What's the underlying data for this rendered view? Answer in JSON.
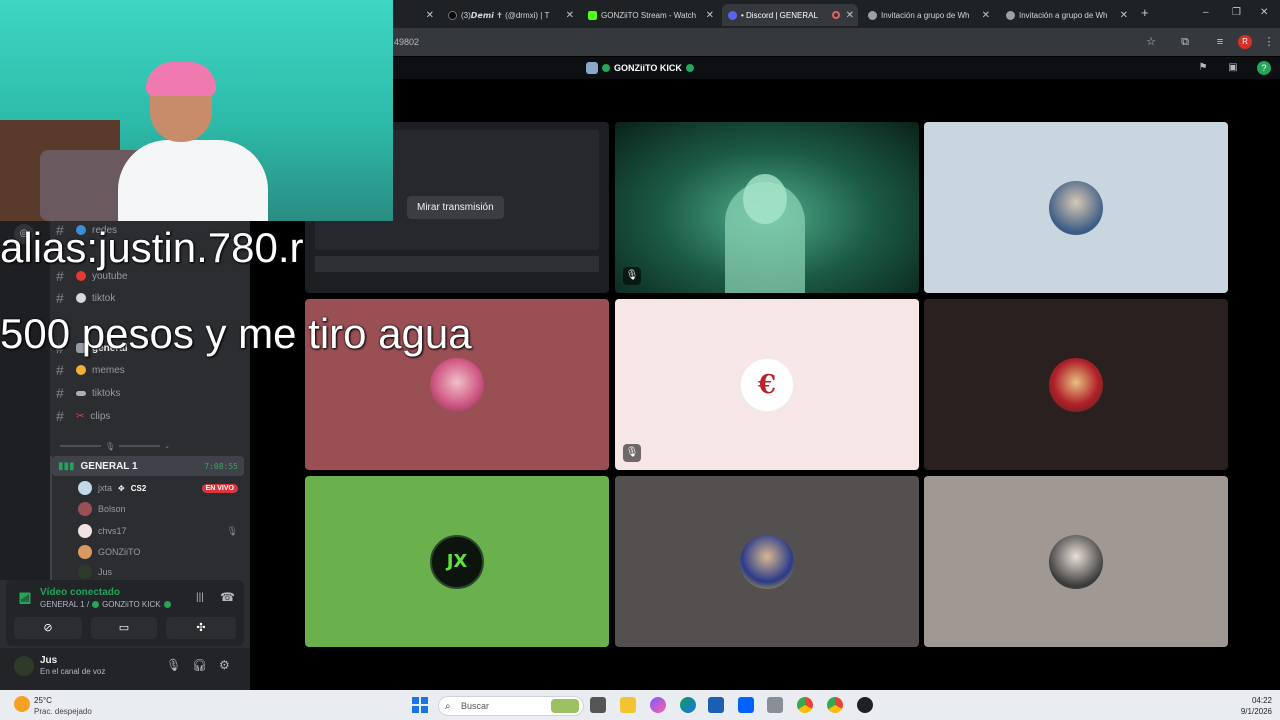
{
  "browser": {
    "tabs": [
      {
        "label": "(3)𝘿𝙚𝙢𝙞 ✝ (@drmxi) | T",
        "color": "#000000"
      },
      {
        "label": "GONZiiTO Stream - Watch",
        "color": "#53fc18"
      },
      {
        "label": "• Discord | GENERAL",
        "color": "#5865f2"
      },
      {
        "label": "Invitación a grupo de Wh",
        "color": "#9aa0a6"
      },
      {
        "label": "Invitación a grupo de Wh",
        "color": "#9aa0a6"
      }
    ],
    "url_fragment": "49802",
    "profile_initial": "R"
  },
  "discord": {
    "header": {
      "call_name": "GONZiiTO KICK"
    },
    "stage": {
      "watch_button": "Mirar transmisión",
      "tiles": [
        {
          "name": "stream-preview",
          "bg": "#1e1f22"
        },
        {
          "name": "camera-feed",
          "bg": "#0f3a2e"
        },
        {
          "name": "avatar-tile-1",
          "bg": "#c9d6df"
        },
        {
          "name": "avatar-tile-2",
          "bg": "#9a4f55"
        },
        {
          "name": "avatar-tile-3",
          "bg": "#f6e6e6"
        },
        {
          "name": "avatar-tile-4",
          "bg": "#2b2020"
        },
        {
          "name": "avatar-tile-5",
          "bg": "#6ab04c"
        },
        {
          "name": "avatar-tile-6",
          "bg": "#545050"
        },
        {
          "name": "avatar-tile-7",
          "bg": "#a09892"
        }
      ],
      "jx_label": "JX"
    },
    "channels": [
      {
        "label": "redes",
        "color": "#3a8fd6"
      },
      {
        "label": "youtube",
        "color": "#e53935"
      },
      {
        "label": "tiktok",
        "color": "#d8d8e0"
      },
      {
        "label": "general",
        "color": "#949ba4"
      },
      {
        "label": "memes",
        "color": "#f0b232"
      },
      {
        "label": "tiktoks",
        "color": "#aab0b8"
      },
      {
        "label": "clips",
        "color": "#ed4245"
      }
    ],
    "voice_channel": {
      "name": "GENERAL 1",
      "timer": "7:08:55",
      "users": [
        {
          "name": "jxta",
          "tag": "CS2",
          "live": "EN VIVO",
          "color": "#c0d8e8"
        },
        {
          "name": "Bolson",
          "color": "#9a4f55"
        },
        {
          "name": "chvs17",
          "color": "#f2e2e2"
        },
        {
          "name": "GONZiiTO",
          "color": "#d89a60"
        },
        {
          "name": "Jus",
          "color": "#2f3b2a"
        }
      ]
    },
    "voice_panel": {
      "status": "Vídeo conectado",
      "channel_path": "GENERAL 1 /",
      "call_name": "GONZiiTO KICK"
    },
    "user": {
      "name": "Jus",
      "status": "En el canal de voz"
    }
  },
  "overlay": {
    "line1": "alias:justin.780.r",
    "line2": "500 pesos y me tiro agua"
  },
  "taskbar": {
    "temperature": "25°C",
    "condition": "Prac. despejado",
    "search_placeholder": "Buscar",
    "time": "04:22",
    "date": "9/1/2026"
  }
}
